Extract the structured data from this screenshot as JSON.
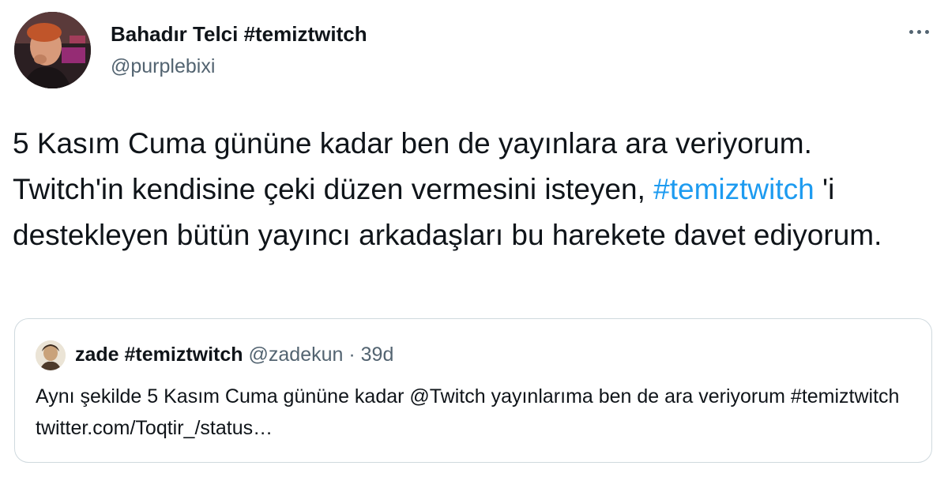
{
  "author": {
    "display_name": "Bahadır Telci #temiztwitch",
    "handle": "@purplebixi",
    "avatar_icon": "profile-photo"
  },
  "more_icon": "more-horizontal-icon",
  "tweet": {
    "text_before_hashtag": "5 Kasım Cuma gününe kadar ben de yayınlara ara veriyorum. Twitch'in kendisine çeki düzen vermesini isteyen, ",
    "hashtag": "#temiztwitch",
    "text_after_hashtag": " 'i destekleyen bütün yayıncı arkadaşları bu harekete davet ediyorum."
  },
  "quoted_tweet": {
    "display_name": "zade #temiztwitch",
    "handle": "@zadekun",
    "separator": "·",
    "time": "39d",
    "text": "Aynı şekilde 5 Kasım Cuma gününe kadar @Twitch yayınlarıma ben de ara veriyorum #temiztwitch twitter.com/Toqtir_/status…"
  },
  "colors": {
    "hashtag": "#1d9bf0",
    "secondary_text": "#536471",
    "primary_text": "#0f1419",
    "border": "#cfd9de"
  }
}
